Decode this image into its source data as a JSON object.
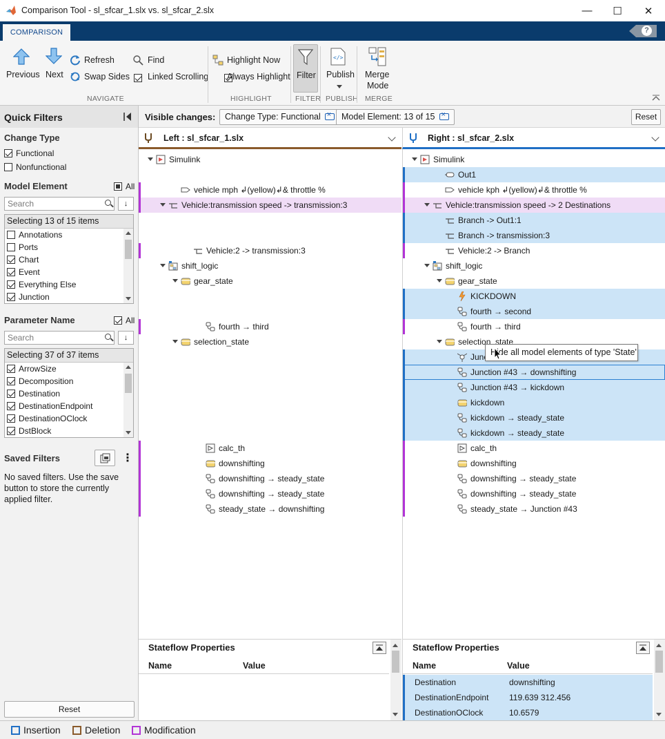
{
  "window": {
    "title": "Comparison Tool - sl_sfcar_1.slx vs. sl_sfcar_2.slx",
    "minimize": "—",
    "maximize": "☐",
    "close": "✕"
  },
  "ribbon": {
    "tab": "COMPARISON",
    "help": "?",
    "previous": "Previous",
    "next": "Next",
    "refresh": "Refresh",
    "swap_sides": "Swap Sides",
    "find": "Find",
    "linked_scrolling": "Linked Scrolling",
    "highlight_now": "Highlight Now",
    "always_highlight": "Always Highlight",
    "filter": "Filter",
    "publish": "Publish",
    "merge_mode_1": "Merge",
    "merge_mode_2": "Mode",
    "sections": {
      "navigate": "NAVIGATE",
      "highlight": "HIGHLIGHT",
      "filter": "FILTER",
      "publish": "PUBLISH",
      "merge": "MERGE"
    }
  },
  "quick_filters": {
    "title": "Quick Filters",
    "change_type": {
      "heading": "Change Type",
      "items": [
        {
          "label": "Functional",
          "checked": true
        },
        {
          "label": "Nonfunctional",
          "checked": false
        }
      ]
    },
    "model_element": {
      "heading": "Model Element",
      "all": "All",
      "search_placeholder": "Search",
      "sort": "↓",
      "summary": "Selecting 13 of 15 items",
      "items": [
        {
          "label": "Annotations",
          "checked": false
        },
        {
          "label": "Ports",
          "checked": false
        },
        {
          "label": "Chart",
          "checked": true
        },
        {
          "label": "Event",
          "checked": true
        },
        {
          "label": "Everything Else",
          "checked": true
        },
        {
          "label": "Junction",
          "checked": true
        }
      ]
    },
    "parameter_name": {
      "heading": "Parameter Name",
      "all": "All",
      "search_placeholder": "Search",
      "sort": "↓",
      "summary": "Selecting 37 of 37 items",
      "items": [
        {
          "label": "ArrowSize",
          "checked": true
        },
        {
          "label": "Decomposition",
          "checked": true
        },
        {
          "label": "Destination",
          "checked": true
        },
        {
          "label": "DestinationEndpoint",
          "checked": true
        },
        {
          "label": "DestinationOClock",
          "checked": true
        },
        {
          "label": "DstBlock",
          "checked": true
        }
      ]
    },
    "saved_filters": {
      "heading": "Saved Filters",
      "empty": "No saved filters. Use the save button to store the currently applied filter."
    },
    "reset": "Reset"
  },
  "visible_changes": {
    "label": "Visible changes:",
    "chips": [
      "Change Type: Functional",
      "Model Element: 13 of 15"
    ],
    "reset": "Reset"
  },
  "left_pane": {
    "header": "Left : sl_sfcar_1.slx",
    "rows": [
      {
        "text": "Simulink",
        "indent": 0,
        "icon": "model-icon",
        "expand": true,
        "state": "none",
        "slot": 0
      },
      {
        "text": "vehicle mph ↲(yellow)↲& throttle %",
        "indent": 2,
        "icon": "port-icon",
        "expand": false,
        "state": "bar",
        "slot": 2
      },
      {
        "text": "Vehicle:transmission speed -> transmission:3",
        "indent": 1,
        "icon": "line-icon",
        "expand": true,
        "state": "mod",
        "slot": 3
      },
      {
        "text": "Vehicle:2 -> transmission:3",
        "indent": 3,
        "icon": "line-icon",
        "expand": false,
        "state": "bar",
        "slot": 6
      },
      {
        "text": "shift_logic",
        "indent": 1,
        "icon": "chart-icon",
        "expand": true,
        "state": "none",
        "slot": 7
      },
      {
        "text": "gear_state",
        "indent": 2,
        "icon": "state-icon",
        "expand": true,
        "state": "none",
        "slot": 8
      },
      {
        "text": "fourth → third",
        "indent": 4,
        "icon": "transition-icon",
        "expand": false,
        "state": "bar",
        "slot": 11
      },
      {
        "text": "selection_state",
        "indent": 2,
        "icon": "state-icon",
        "expand": true,
        "state": "none",
        "slot": 12
      },
      {
        "text": "calc_th",
        "indent": 4,
        "icon": "function-icon",
        "expand": false,
        "state": "bar",
        "slot": 19
      },
      {
        "text": "downshifting",
        "indent": 4,
        "icon": "state-icon",
        "expand": false,
        "state": "bar",
        "slot": 20
      },
      {
        "text": "downshifting → steady_state",
        "indent": 4,
        "icon": "transition-icon",
        "expand": false,
        "state": "bar",
        "slot": 21
      },
      {
        "text": "downshifting → steady_state",
        "indent": 4,
        "icon": "transition-icon",
        "expand": false,
        "state": "bar",
        "slot": 22
      },
      {
        "text": "steady_state → downshifting",
        "indent": 4,
        "icon": "transition-icon",
        "expand": false,
        "state": "bar",
        "slot": 23
      }
    ]
  },
  "right_pane": {
    "header": "Right : sl_sfcar_2.slx",
    "rows": [
      {
        "text": "Simulink",
        "indent": 0,
        "icon": "model-icon",
        "expand": true,
        "state": "none",
        "slot": 0
      },
      {
        "text": "Out1",
        "indent": 2,
        "icon": "outport-icon",
        "expand": false,
        "state": "ins",
        "slot": 1
      },
      {
        "text": "vehicle kph ↲(yellow)↲& throttle %",
        "indent": 2,
        "icon": "port-icon",
        "expand": false,
        "state": "bar",
        "slot": 2
      },
      {
        "text": "Vehicle:transmission speed -> 2 Destinations",
        "indent": 1,
        "icon": "line-icon",
        "expand": true,
        "state": "mod",
        "slot": 3
      },
      {
        "text": "Branch -> Out1:1",
        "indent": 2,
        "icon": "line-icon",
        "expand": false,
        "state": "ins",
        "slot": 4
      },
      {
        "text": "Branch -> transmission:3",
        "indent": 2,
        "icon": "line-icon",
        "expand": false,
        "state": "ins",
        "slot": 5
      },
      {
        "text": "Vehicle:2 -> Branch",
        "indent": 2,
        "icon": "line-icon",
        "expand": false,
        "state": "bar",
        "slot": 6
      },
      {
        "text": "shift_logic",
        "indent": 1,
        "icon": "chart-icon",
        "expand": true,
        "state": "none",
        "slot": 7
      },
      {
        "text": "gear_state",
        "indent": 2,
        "icon": "state-icon",
        "expand": true,
        "state": "none",
        "slot": 8
      },
      {
        "text": "KICKDOWN",
        "indent": 3,
        "icon": "event-icon",
        "expand": false,
        "state": "ins",
        "slot": 9
      },
      {
        "text": "fourth → second",
        "indent": 3,
        "icon": "transition-icon",
        "expand": false,
        "state": "ins",
        "slot": 10
      },
      {
        "text": "fourth → third",
        "indent": 3,
        "icon": "transition-icon",
        "expand": false,
        "state": "bar",
        "slot": 11
      },
      {
        "text": "selection_state",
        "indent": 2,
        "icon": "state-icon",
        "expand": true,
        "state": "none",
        "slot": 12
      },
      {
        "text": "Junc",
        "indent": 3,
        "icon": "junction-icon",
        "expand": false,
        "state": "ins",
        "slot": 13
      },
      {
        "text": "Junction #43 → downshifting",
        "indent": 3,
        "icon": "transition-icon",
        "expand": false,
        "state": "ins-sel",
        "slot": 14
      },
      {
        "text": "Junction #43 → kickdown",
        "indent": 3,
        "icon": "transition-icon",
        "expand": false,
        "state": "ins",
        "slot": 15
      },
      {
        "text": "kickdown",
        "indent": 3,
        "icon": "state-icon",
        "expand": false,
        "state": "ins",
        "slot": 16
      },
      {
        "text": "kickdown → steady_state",
        "indent": 3,
        "icon": "transition-icon",
        "expand": false,
        "state": "ins",
        "slot": 17
      },
      {
        "text": "kickdown → steady_state",
        "indent": 3,
        "icon": "transition-icon",
        "expand": false,
        "state": "ins",
        "slot": 18
      },
      {
        "text": "calc_th",
        "indent": 3,
        "icon": "function-icon",
        "expand": false,
        "state": "bar",
        "slot": 19
      },
      {
        "text": "downshifting",
        "indent": 3,
        "icon": "state-icon",
        "expand": false,
        "state": "bar",
        "slot": 20
      },
      {
        "text": "downshifting → steady_state",
        "indent": 3,
        "icon": "transition-icon",
        "expand": false,
        "state": "bar",
        "slot": 21
      },
      {
        "text": "downshifting → steady_state",
        "indent": 3,
        "icon": "transition-icon",
        "expand": false,
        "state": "bar",
        "slot": 22
      },
      {
        "text": "steady_state → Junction #43",
        "indent": 3,
        "icon": "transition-icon",
        "expand": false,
        "state": "bar",
        "slot": 23
      }
    ]
  },
  "tooltip": "Hide all model elements of type 'State'",
  "left_props": {
    "title": "Stateflow Properties",
    "col_name": "Name",
    "col_value": "Value"
  },
  "right_props": {
    "title": "Stateflow Properties",
    "col_name": "Name",
    "col_value": "Value",
    "rows": [
      {
        "name": "Destination",
        "value": "downshifting"
      },
      {
        "name": "DestinationEndpoint",
        "value": "119.639 312.456"
      },
      {
        "name": "DestinationOClock",
        "value": "10.6579"
      }
    ]
  },
  "legend": {
    "insertion": "Insertion",
    "deletion": "Deletion",
    "modification": "Modification"
  },
  "colors": {
    "insertion": "#1f6fc5",
    "deletion": "#8a5a2b",
    "modification": "#b234d6",
    "insert_bg": "#cce4f7",
    "modify_bg": "#f0dcf6",
    "ribbon_tab_bg": "#0a3b6c"
  }
}
